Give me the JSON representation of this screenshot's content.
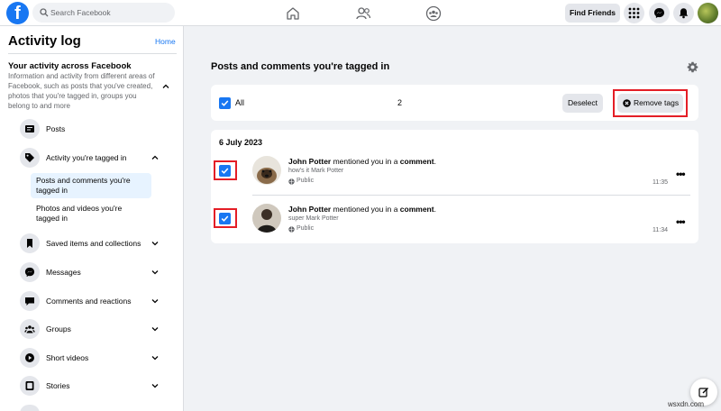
{
  "topbar": {
    "logo_letter": "f",
    "search_placeholder": "Search Facebook",
    "nav_icons": [
      "home-icon",
      "friends-icon",
      "groups-icon"
    ],
    "find_friends_label": "Find Friends",
    "right_icons": [
      "menu-grid-icon",
      "messenger-icon",
      "notifications-icon"
    ]
  },
  "sidebar": {
    "title": "Activity log",
    "home_link": "Home",
    "section_title": "Your activity across Facebook",
    "section_desc": "Information and activity from different areas of Facebook, such as posts that you've created, photos that you're tagged in, groups you belong to and more",
    "items": [
      {
        "label": "Posts",
        "icon": "posts-icon",
        "chevron": "none"
      },
      {
        "label": "Activity you're tagged in",
        "icon": "tag-icon",
        "chevron": "up"
      },
      {
        "label": "Saved items and collections",
        "icon": "bookmark-icon",
        "chevron": "down"
      },
      {
        "label": "Messages",
        "icon": "messenger-icon",
        "chevron": "down"
      },
      {
        "label": "Comments and reactions",
        "icon": "comment-icon",
        "chevron": "down"
      },
      {
        "label": "Groups",
        "icon": "groups-icon",
        "chevron": "down"
      },
      {
        "label": "Short videos",
        "icon": "video-icon",
        "chevron": "down"
      },
      {
        "label": "Stories",
        "icon": "stories-icon",
        "chevron": "down"
      }
    ],
    "sub_items": [
      {
        "label": "Posts and comments you're tagged in",
        "active": true
      },
      {
        "label": "Photos and videos you're tagged in",
        "active": false
      }
    ]
  },
  "main": {
    "title": "Posts and comments you're tagged in",
    "toolbar": {
      "all_label": "All",
      "selected_count": "2",
      "deselect_label": "Deselect",
      "remove_tags_label": "Remove tags"
    },
    "date_heading": "6 July 2023",
    "posts": [
      {
        "name": "John Potter",
        "action": " mentioned you in a ",
        "object": "comment",
        "text": "how's it Mark Potter",
        "audience": "Public",
        "time": "11:35",
        "checked": true
      },
      {
        "name": "John Potter",
        "action": " mentioned you in a ",
        "object": "comment",
        "text": "super Mark Potter",
        "audience": "Public",
        "time": "11:34",
        "checked": true
      }
    ]
  },
  "watermark": "wsxdn.com",
  "colors": {
    "brand_blue": "#1877f2",
    "highlight_red": "#e41e26",
    "active_bg": "#e7f3ff"
  }
}
